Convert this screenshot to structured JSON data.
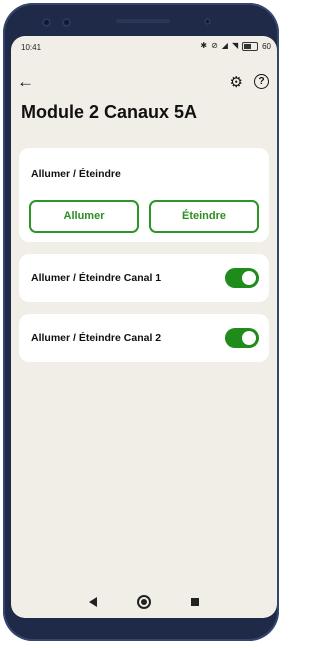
{
  "status_bar": {
    "time": "10:41",
    "battery_text": "60"
  },
  "app_bar": {
    "back_icon": "arrow-left-icon",
    "settings_icon": "gear-icon",
    "help_icon": "question-icon",
    "help_glyph": "?"
  },
  "page": {
    "title": "Module 2 Canaux 5A"
  },
  "cards": {
    "power": {
      "label": "Allumer / Éteindre",
      "on_button": "Allumer",
      "off_button": "Éteindre"
    },
    "channel1": {
      "label": "Allumer / Éteindre Canal 1",
      "enabled": true
    },
    "channel2": {
      "label": "Allumer / Éteindre Canal 2",
      "enabled": true
    }
  },
  "colors": {
    "accent": "#2e9626",
    "toggle_on": "#1e8b1a",
    "background": "#f1eee7"
  }
}
